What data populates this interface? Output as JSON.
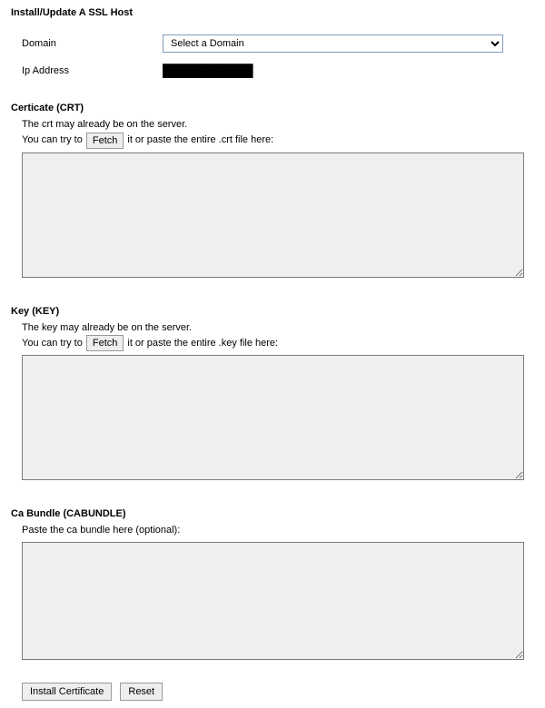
{
  "title": "Install/Update A SSL Host",
  "fields": {
    "domain_label": "Domain",
    "domain_selected": "Select a Domain",
    "ip_label": "Ip Address",
    "ip_value": "████████████"
  },
  "crt": {
    "heading": "Certicate (CRT)",
    "help1": "The crt may already be on the server.",
    "help2_pre": "You can try to",
    "fetch_label": "Fetch",
    "help2_post": "it or paste the entire .crt file here:",
    "value": ""
  },
  "key": {
    "heading": "Key (KEY)",
    "help1": "The key may already be on the server.",
    "help2_pre": "You can try to",
    "fetch_label": "Fetch",
    "help2_post": "it or paste the entire .key file here:",
    "value": ""
  },
  "cabundle": {
    "heading": "Ca Bundle (CABUNDLE)",
    "help1": "Paste the ca bundle here (optional):",
    "value": ""
  },
  "actions": {
    "install": "Install Certificate",
    "reset": "Reset"
  }
}
